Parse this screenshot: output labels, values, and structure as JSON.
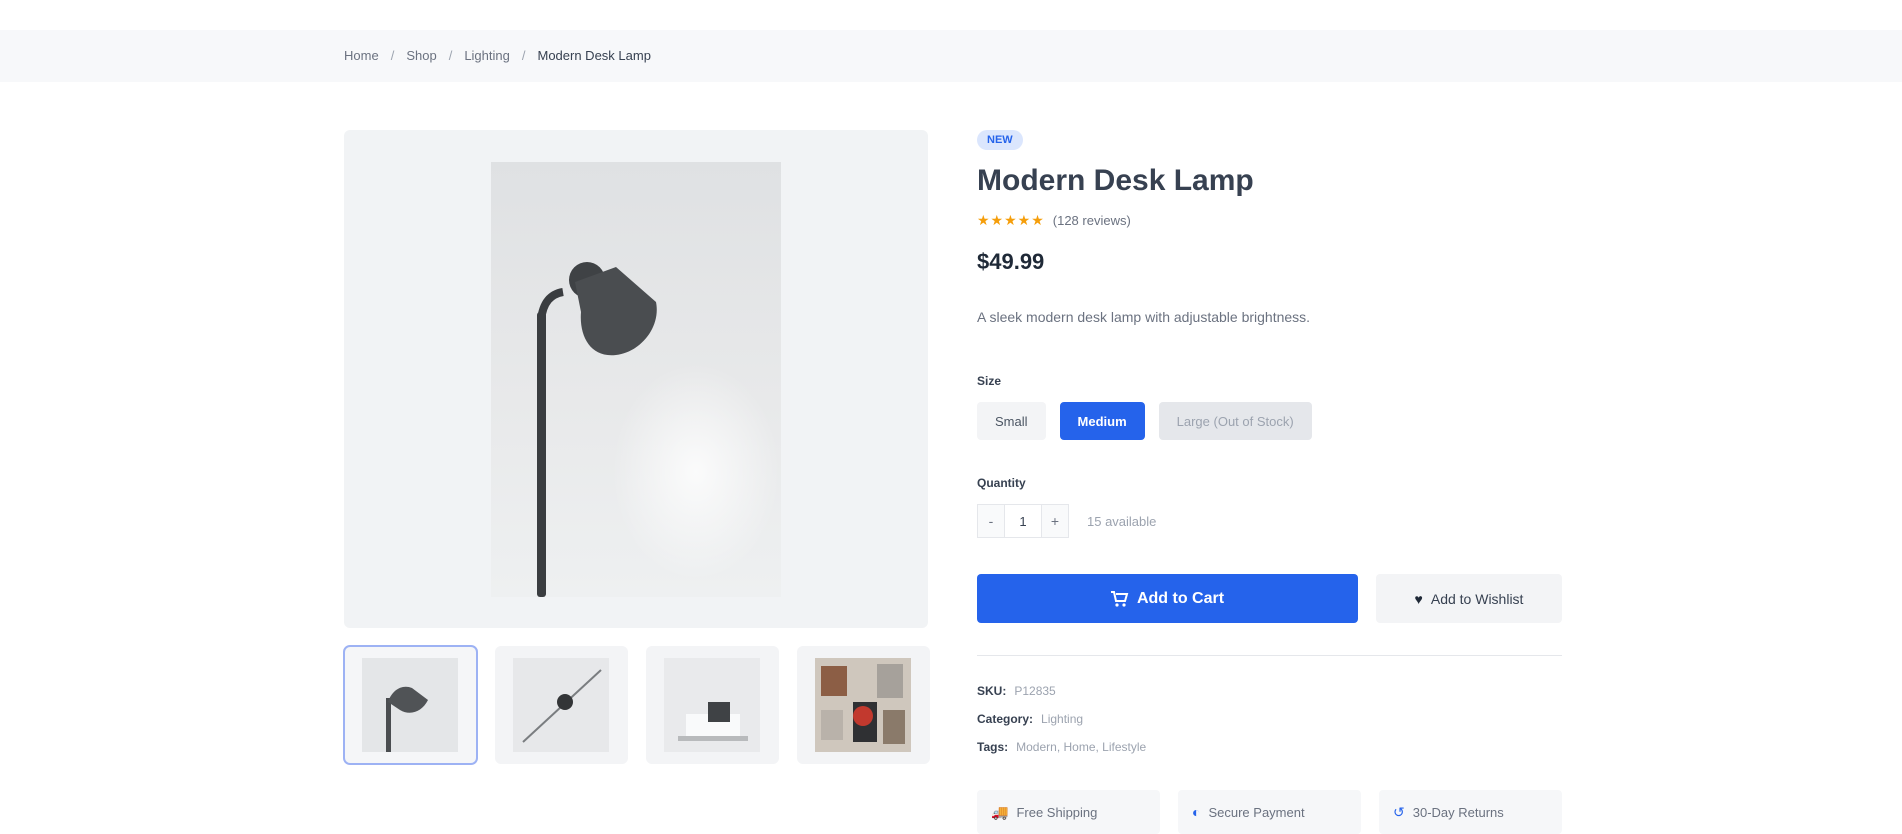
{
  "breadcrumb": [
    "Home",
    "Shop",
    "Lighting",
    "Modern Desk Lamp"
  ],
  "product": {
    "badge": "NEW",
    "title": "Modern Desk Lamp",
    "stars": "★★★★★",
    "reviews": "(128 reviews)",
    "price": "$49.99",
    "description": "A sleek modern desk lamp with adjustable brightness."
  },
  "size": {
    "label": "Size",
    "options": [
      "Small",
      "Medium",
      "Large (Out of Stock)"
    ],
    "selected": "Medium"
  },
  "quantity": {
    "label": "Quantity",
    "minus": "-",
    "value": "1",
    "plus": "+",
    "available": "15 available"
  },
  "actions": {
    "add_to_cart": "Add to Cart",
    "wishlist": "Add to Wishlist"
  },
  "meta": {
    "sku_label": "SKU:",
    "sku": "P12835",
    "category_label": "Category:",
    "category": "Lighting",
    "tags_label": "Tags:",
    "tags": "Modern, Home, Lifestyle"
  },
  "features": [
    "Free Shipping",
    "Secure Payment",
    "30-Day Returns"
  ],
  "thumbnails": [
    "lamp-front",
    "lamp-wall",
    "desk-setup",
    "shelf-decor"
  ],
  "colors": {
    "accent": "#2563eb",
    "star": "#f59e0b"
  }
}
